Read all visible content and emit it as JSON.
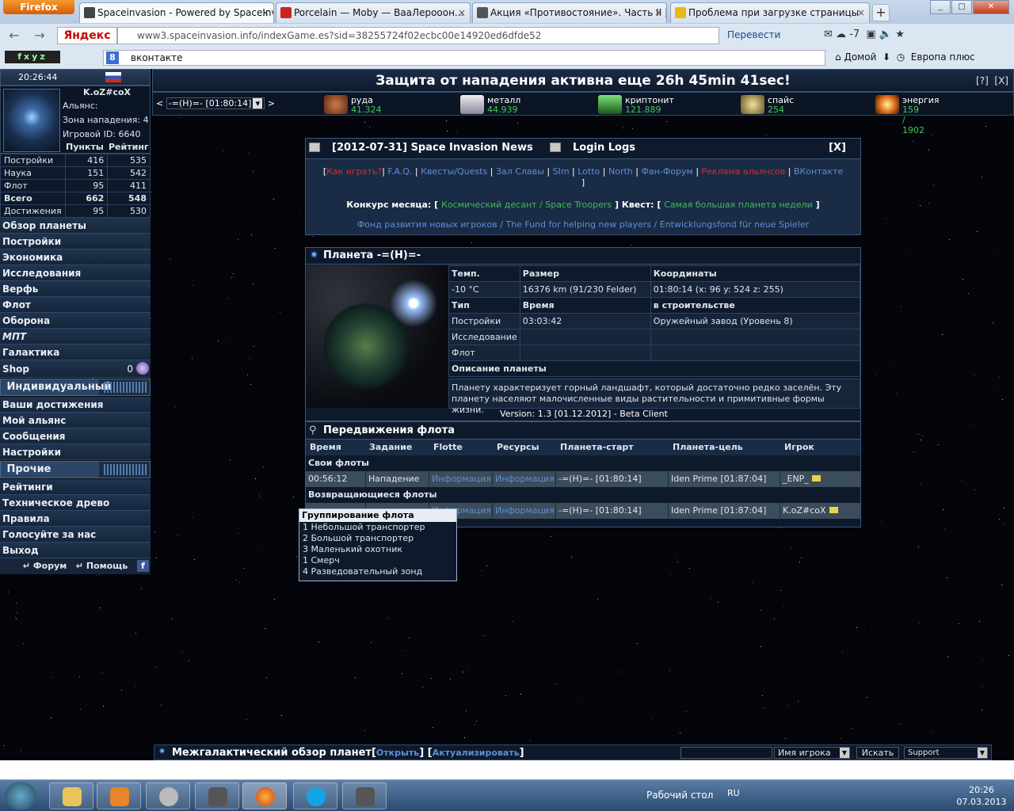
{
  "browser": {
    "app_button": "Firefox",
    "tabs": [
      {
        "title": "Spaceinvasion - Powered by SpaceInv..."
      },
      {
        "title": "Porcelain — Moby — ВааЛерооон..."
      },
      {
        "title": "Акция «Противостояние». Часть II | ..."
      },
      {
        "title": "Проблема при загрузке страницы"
      }
    ],
    "new_tab": "+",
    "search_engine": "Яндекс",
    "url": "www3.spaceinvasion.info/indexGame.es?sid=38255724f02ecbc00e14920ed6dfde52",
    "translate": "Перевести",
    "weather": "-7",
    "toolbar_brand": "fxyz",
    "search_query": "вконтакте",
    "home_label": "Домой",
    "bookmark_label": "Европа плюс"
  },
  "sidebar": {
    "time": "20:26:44",
    "player_name": "K.oZ#coX",
    "alliance": "Альянс:",
    "attack_zone": "Зона нападения: 4",
    "player_id": "Игровой ID: 6640",
    "stats_headers": [
      "Пункты",
      "Рейтинг"
    ],
    "stats": [
      {
        "label": "Постройки",
        "points": "416",
        "rank": "535"
      },
      {
        "label": "Наука",
        "points": "151",
        "rank": "542"
      },
      {
        "label": "Флот",
        "points": "95",
        "rank": "411"
      },
      {
        "label": "Всего",
        "points": "662",
        "rank": "548"
      },
      {
        "label": "Достижения",
        "points": "95",
        "rank": "530"
      }
    ],
    "menu_main": [
      "Обзор планеты",
      "Постройки",
      "Экономика",
      "Исследования",
      "Верфь",
      "Флот",
      "Оборона",
      "МПТ",
      "Галактика"
    ],
    "shop_label": "Shop",
    "shop_count": "0",
    "section_individual": "Индивидуальный",
    "menu_individual": [
      "Ваши достижения",
      "Мой альянс",
      "Сообщения",
      "Настройки"
    ],
    "section_other": "Прочие",
    "menu_other": [
      "Рейтинги",
      "Техническое древо",
      "Правила",
      "Голосуйте за нас",
      "Выход"
    ],
    "forum_link": "Форум",
    "help_link": "Помощь"
  },
  "header": {
    "protection_text": "Защита от нападения активна еще 26h 45min 41sec!",
    "help_btn": "[?]",
    "close_btn": "[X]",
    "planet_select": "-=(H)=- [01:80:14]"
  },
  "resources": [
    {
      "name": "руда",
      "value": "41.324"
    },
    {
      "name": "металл",
      "value": "44.939"
    },
    {
      "name": "криптонит",
      "value": "121.889"
    },
    {
      "name": "спайс",
      "value": "254"
    },
    {
      "name": "энергия",
      "value": "159 / 1902"
    }
  ],
  "news": {
    "title": "[2012-07-31] Space Invasion News",
    "login_logs": "Login Logs",
    "close": "[X]",
    "links": [
      {
        "label": "Как играть?",
        "color": "#e3242b"
      },
      {
        "label": "F.A.Q.",
        "color": "#5d8fd6"
      },
      {
        "label": "Квесты/Quests",
        "color": "#5d8fd6"
      },
      {
        "label": "Зал Славы",
        "color": "#5d8fd6"
      },
      {
        "label": "SIm",
        "color": "#5d8fd6"
      },
      {
        "label": "Lotto",
        "color": "#5d8fd6"
      },
      {
        "label": "North",
        "color": "#5d8fd6"
      },
      {
        "label": "Фан-Форум",
        "color": "#5d8fd6"
      },
      {
        "label": "Реклама альянсов",
        "color": "#e3242b"
      },
      {
        "label": "ВКонтакте",
        "color": "#5d8fd6"
      }
    ],
    "contest_label": "Конкурс месяца:",
    "contest_value": "Космический десант / Space Troopers",
    "quest_label": "Квест:",
    "quest_value": "Самая большая планета недели",
    "fund": "Фонд развития новых игроков / The Fund for helping new players / Entwicklungsfond für neue Spieler"
  },
  "planet": {
    "title": "Планета -=(H)=-",
    "temp_label": "Темп.",
    "size_label": "Размер",
    "coords_label": "Координаты",
    "temp": "-10 °C",
    "size": "16376 km (91/230 Felder)",
    "coords": "01:80:14 (x: 96 y: 524 z: 255)",
    "type_label": "Тип",
    "time_label": "Время",
    "building_label": "в строительстве",
    "buildings_label": "Постройки",
    "buildings_time": "03:03:42",
    "buildings_item": "Оружейный завод (Уровень 8)",
    "research_label": "Исследование",
    "fleet_label": "Флот",
    "desc_label": "Описание планеты",
    "description": "Планету характеризует горный ландшафт, который достаточно редко заселён. Эту планету населяют малочисленные виды растительности и примитивные формы жизни.",
    "version": "Version: 1.3 [01.12.2012] - Beta Client"
  },
  "fleet": {
    "title": "Передвижения флота",
    "columns": [
      "Время",
      "Задание",
      "Flotte",
      "Ресурсы",
      "Планета-старт",
      "Планета-цель",
      "Игрок"
    ],
    "own_label": "Свои флоты",
    "own_row": {
      "time": "00:56:12",
      "mission": "Нападение",
      "fleet": "Информация",
      "res": "Информация",
      "start": "-=(H)=- [01:80:14]",
      "target": "Iden Prime [01:87:04]",
      "player": "_ENP_"
    },
    "return_label": "Возвращающиеся флоты",
    "return_row": {
      "fleet": "Информация",
      "res": "Информация",
      "start": "-=(H)=- [01:80:14]",
      "target": "Iden Prime [01:87:04]",
      "player": "K.oZ#coX"
    }
  },
  "popup": {
    "title": "Группирование флота",
    "rows": [
      "1 Небольшой транспортер",
      "2 Большой транспортер",
      "3 Маленький охотник",
      "1 Смерч",
      "4 Разведовательный зонд"
    ]
  },
  "bottom": {
    "title": "Межгалактический обзор планет",
    "open": "Открыть",
    "update": "Актуализировать",
    "select": "Имя игрока",
    "search_btn": "Искать",
    "support": "Support"
  },
  "taskbar": {
    "desktop": "Рабочий стол",
    "lang": "RU",
    "time": "20:26",
    "date": "07.03.2013"
  }
}
